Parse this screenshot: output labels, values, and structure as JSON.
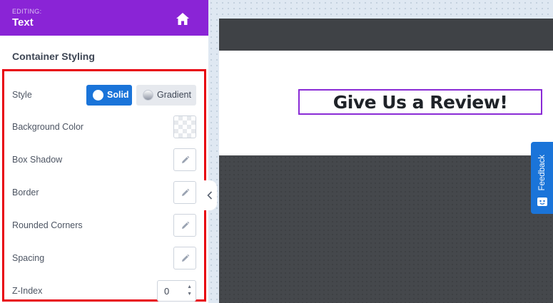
{
  "header": {
    "editing_label": "EDITING:",
    "editing_value": "Text",
    "home_icon": "home-icon"
  },
  "panel": {
    "section_title": "Container Styling",
    "style": {
      "label": "Style",
      "options": [
        {
          "label": "Solid",
          "selected": true
        },
        {
          "label": "Gradient",
          "selected": false
        }
      ]
    },
    "background_color": {
      "label": "Background Color",
      "value": "transparent"
    },
    "box_shadow": {
      "label": "Box Shadow",
      "icon": "pencil-icon"
    },
    "border": {
      "label": "Border",
      "icon": "pencil-icon"
    },
    "rounded_corners": {
      "label": "Rounded Corners",
      "icon": "pencil-icon"
    },
    "spacing": {
      "label": "Spacing",
      "icon": "pencil-icon"
    },
    "z_index": {
      "label": "Z-Index",
      "value": "0"
    }
  },
  "canvas": {
    "headline": "Give Us a Review!"
  },
  "feedback": {
    "label": "Feedback",
    "icon": "feedback-face-icon"
  },
  "colors": {
    "header_bg": "#8a24d6",
    "accent_blue": "#1a74d9",
    "highlight_red": "#e8000d",
    "selection_purple": "#8a2bd6"
  }
}
